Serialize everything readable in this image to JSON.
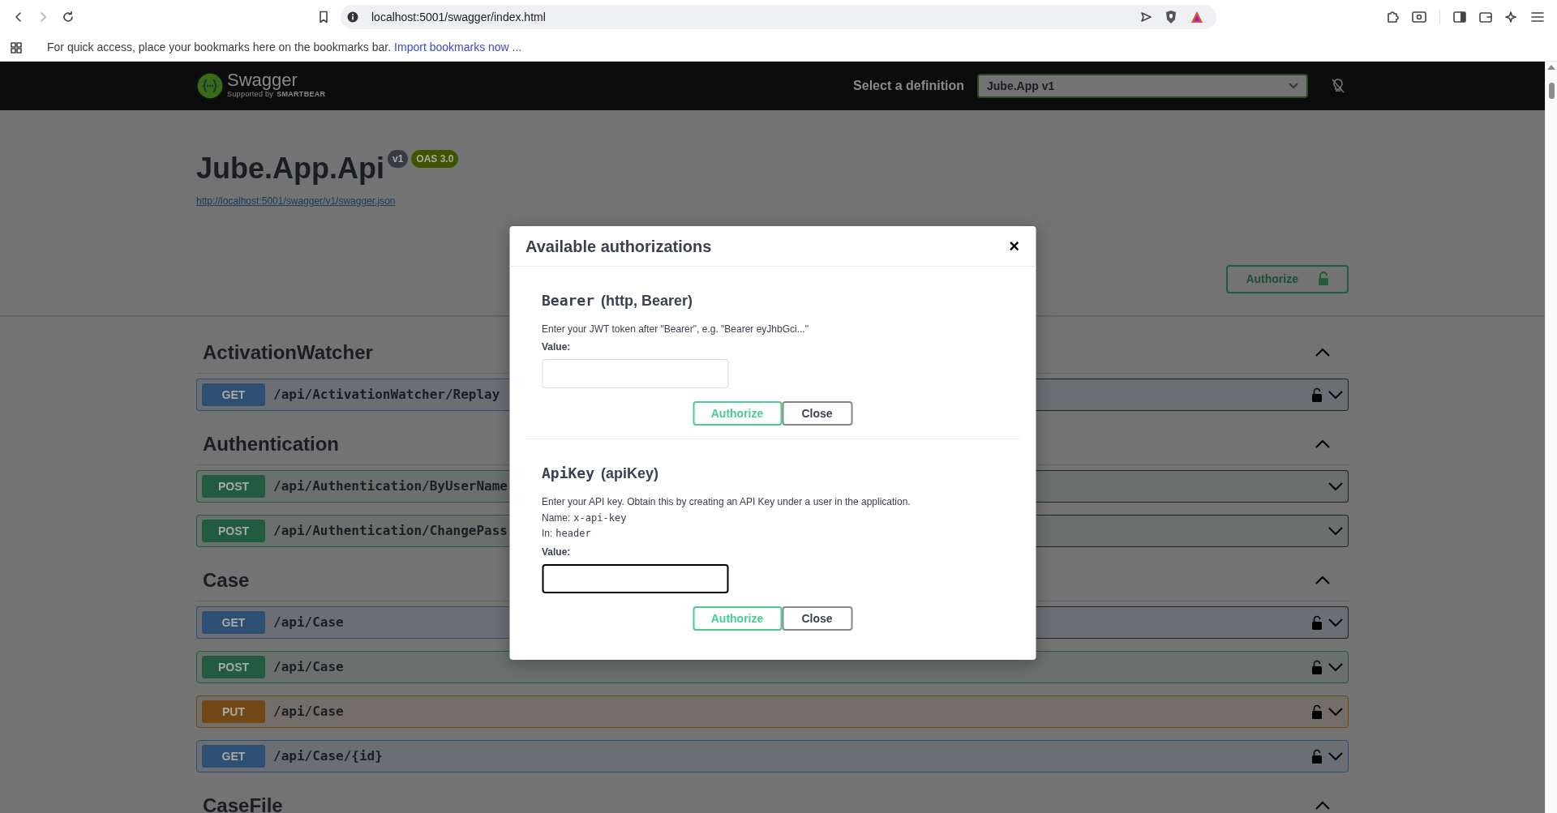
{
  "browser": {
    "url": "localhost:5001/swagger/index.html",
    "bookmarks_hint": "For quick access, place your bookmarks here on the bookmarks bar.",
    "import_link": "Import bookmarks now ..."
  },
  "topbar": {
    "logo_text": "Swagger",
    "logo_tagline": "Supported by",
    "logo_brand": "SMARTBEAR",
    "definition_label": "Select a definition",
    "definition_value": "Jube.App v1"
  },
  "info": {
    "title": "Jube.App.Api",
    "version": "v1",
    "oas": "OAS 3.0",
    "spec_url": "http://localhost:5001/swagger/v1/swagger.json"
  },
  "authorize_button": "Authorize",
  "tags": [
    {
      "name": "ActivationWatcher",
      "expanded": true,
      "operations": [
        {
          "method": "GET",
          "color": "#2c4f72",
          "path": "/api/ActivationWatcher/Replay",
          "secured": true
        }
      ]
    },
    {
      "name": "Authentication",
      "expanded": true,
      "operations": [
        {
          "method": "POST",
          "color": "#215c41",
          "path": "/api/Authentication/ByUserName",
          "secured": false
        },
        {
          "method": "POST",
          "color": "#215c41",
          "path": "/api/Authentication/ChangePass",
          "secured": false
        }
      ]
    },
    {
      "name": "Case",
      "expanded": true,
      "operations": [
        {
          "method": "GET",
          "color": "#2c4f72",
          "path": "/api/Case",
          "secured": true
        },
        {
          "method": "POST",
          "color": "#215c41",
          "path": "/api/Case",
          "secured": true
        },
        {
          "method": "PUT",
          "color": "#714816",
          "path": "/api/Case",
          "secured": true
        },
        {
          "method": "GET",
          "color": "#2c4f72",
          "path": "/api/Case/{id}",
          "secured": true
        }
      ]
    },
    {
      "name": "CaseFile",
      "expanded": true
    }
  ],
  "modal": {
    "title": "Available authorizations",
    "close": "×",
    "schemes": [
      {
        "name": "Bearer",
        "type_label": "(http, Bearer)",
        "description": "Enter your JWT token after \"Bearer\", e.g. \"Bearer eyJhbGci...\"",
        "value_label": "Value:",
        "focused": false,
        "buttons": [
          {
            "kind": "authorize",
            "label": "Authorize"
          },
          {
            "kind": "close",
            "label": "Close"
          }
        ]
      },
      {
        "name": "ApiKey",
        "type_label": "(apiKey)",
        "description": "Enter your API key. Obtain this by creating an API Key under a user in the application.",
        "details": [
          {
            "label": "Name:",
            "value": "x-api-key"
          },
          {
            "label": "In:",
            "value": "header"
          }
        ],
        "value_label": "Value:",
        "focused": true,
        "buttons": [
          {
            "kind": "authorize",
            "label": "Authorize"
          },
          {
            "kind": "close",
            "label": "Close"
          }
        ]
      }
    ]
  }
}
